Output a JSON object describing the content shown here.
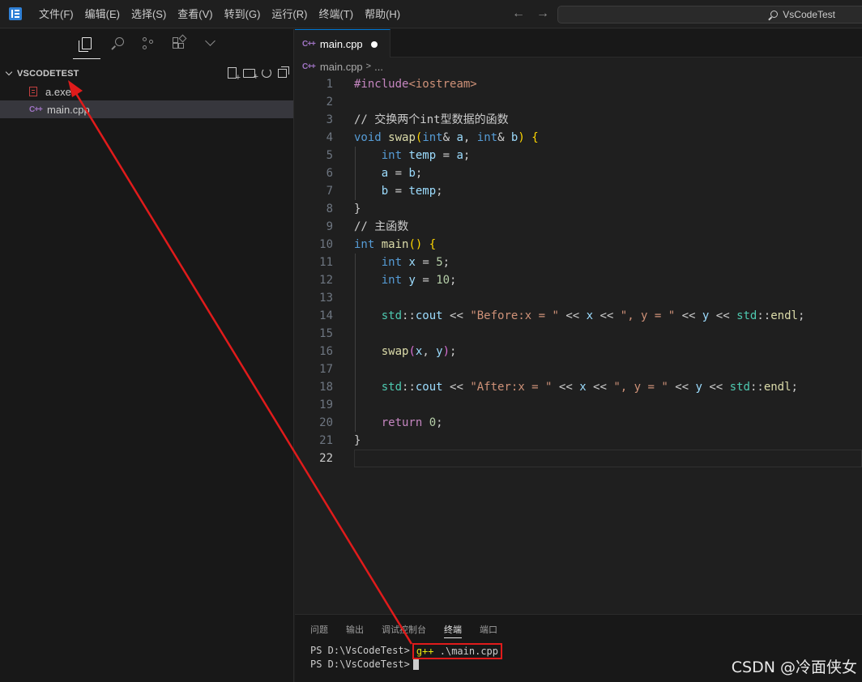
{
  "menu": [
    "文件(F)",
    "编辑(E)",
    "选择(S)",
    "查看(V)",
    "转到(G)",
    "运行(R)",
    "终端(T)",
    "帮助(H)"
  ],
  "search": {
    "label": "VsCodeTest"
  },
  "explorer": {
    "title": "VSCODETEST",
    "files": [
      {
        "name": "a.exe",
        "icon": "exe-file-icon"
      },
      {
        "name": "main.cpp",
        "icon": "cpp-file-icon"
      }
    ]
  },
  "editor": {
    "tab": {
      "label": "main.cpp",
      "icon": "C++"
    },
    "breadcrumb": {
      "file": "main.cpp",
      "sep": ">",
      "rest": "..."
    },
    "line_numbers": [
      "1",
      "2",
      "3",
      "4",
      "5",
      "6",
      "7",
      "8",
      "9",
      "10",
      "11",
      "12",
      "13",
      "14",
      "15",
      "16",
      "17",
      "18",
      "19",
      "20",
      "21",
      "22"
    ],
    "code": {
      "l1_a": "#include",
      "l1_b": "<iostream>",
      "l3": "// 交换两个int型数据的函数",
      "l4": {
        "void": "void",
        "swap": "swap",
        "p": "(",
        "int1": "int",
        "amp1": "& ",
        "a": "a",
        "comma": ", ",
        "int2": "int",
        "amp2": "& ",
        "b": "b",
        "close": ")",
        "brace": "{"
      },
      "l5": {
        "int": "int",
        "temp": "temp",
        "eq": " = ",
        "a": "a",
        "semi": ";"
      },
      "l6": {
        "a": "a",
        "eq": " = ",
        "b": "b",
        "semi": ";"
      },
      "l7": {
        "b": "b",
        "eq": " = ",
        "temp": "temp",
        "semi": ";"
      },
      "l8": "}",
      "l9": "// 主函数",
      "l10": {
        "int": "int",
        "main": "main",
        "parens": "()",
        "brace": "{"
      },
      "l11": {
        "int": "int",
        "x": "x",
        "eq": " = ",
        "val": "5",
        "semi": ";"
      },
      "l12": {
        "int": "int",
        "y": "y",
        "eq": " = ",
        "val": "10",
        "semi": ";"
      },
      "l14": {
        "std": "std",
        "colons": "::",
        "cout": "cout",
        "op1": " << ",
        "s1": "\"Before:x = \"",
        "op2": " << ",
        "x": "x",
        "op3": " << ",
        "s2": "\", y = \"",
        "op4": " << ",
        "y": "y",
        "op5": " << ",
        "std2": "std",
        "colons2": "::",
        "endl": "endl",
        "semi": ";"
      },
      "l16": {
        "swap": "swap",
        "p1": "(",
        "x": "x",
        "comma": ", ",
        "y": "y",
        "p2": ")",
        "semi": ";"
      },
      "l18": {
        "std": "std",
        "colons": "::",
        "cout": "cout",
        "op1": " << ",
        "s1": "\"After:x = \"",
        "op2": " << ",
        "x": "x",
        "op3": " << ",
        "s2": "\", y = \"",
        "op4": " << ",
        "y": "y",
        "op5": " << ",
        "std2": "std",
        "colons2": "::",
        "endl": "endl",
        "semi": ";"
      },
      "l20": {
        "ret": "return",
        "val": "0",
        "semi": ";"
      },
      "l21": "}"
    }
  },
  "panel": {
    "tabs": [
      "问题",
      "输出",
      "调试控制台",
      "终端",
      "端口"
    ],
    "active_tab": "终端",
    "terminal": {
      "prompt1": "PS D:\\VsCodeTest>",
      "cmd_g": "g++",
      "cmd_rest": " .\\main.cpp",
      "prompt2": "PS D:\\VsCodeTest>"
    }
  },
  "watermark": "CSDN @冷面侠女",
  "colors": {
    "annotation": "#e01b1b",
    "accent": "#0078d4"
  }
}
